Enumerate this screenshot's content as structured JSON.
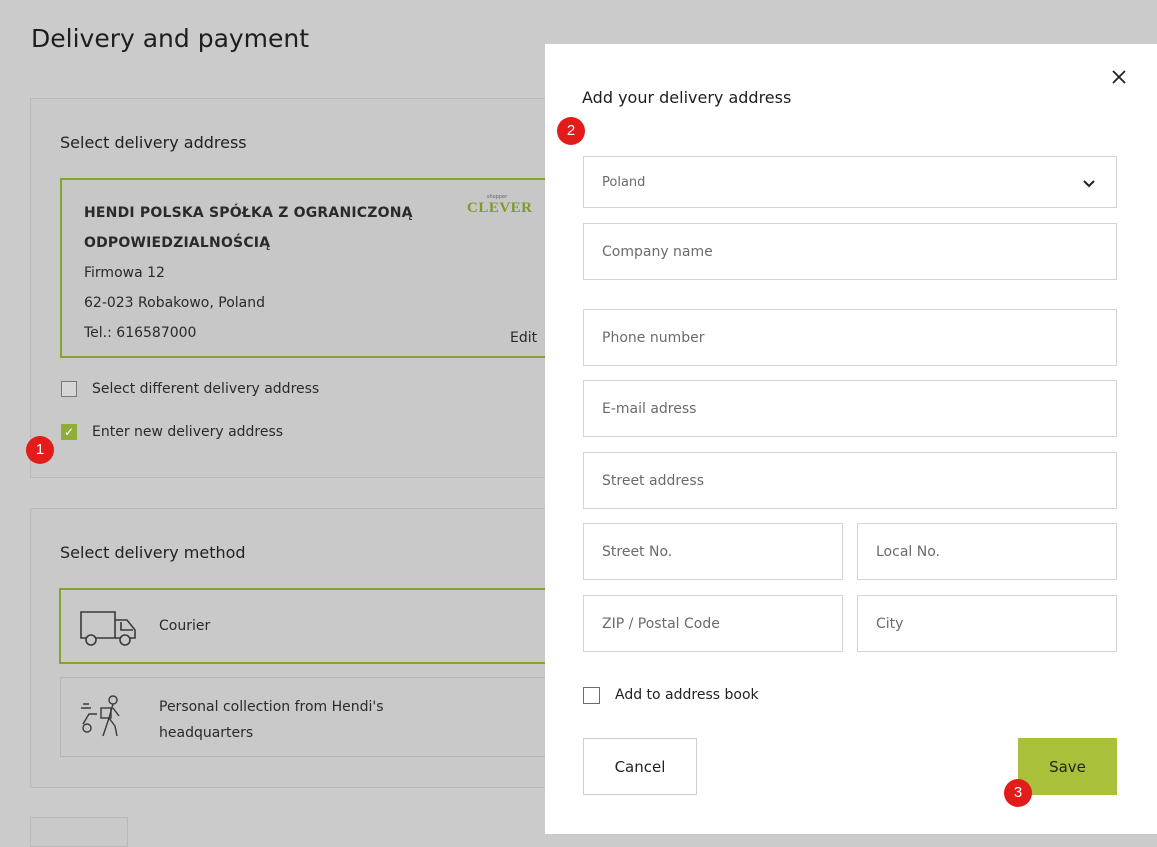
{
  "page": {
    "title": "Delivery and payment"
  },
  "address_section": {
    "title": "Select delivery address",
    "card": {
      "company_line1": "HENDI POLSKA SPÓŁKA Z OGRANICZONĄ",
      "company_line2": "ODPOWIEDZIALNOŚCIĄ",
      "street": "Firmowa 12",
      "city": "62-023 Robakowo, Poland",
      "phone": "Tel.: 616587000",
      "logo_small": "shopper",
      "logo": "CLEVER",
      "edit_label": "Edit"
    },
    "option_different": {
      "label": "Select different delivery address",
      "checked": false
    },
    "option_new": {
      "label": "Enter new delivery address",
      "checked": true
    }
  },
  "method_section": {
    "title": "Select delivery method",
    "methods": [
      {
        "label": "Courier",
        "icon": "truck-icon",
        "selected": true
      },
      {
        "label_line1": "Personal collection from Hendi's",
        "label_line2": "headquarters",
        "icon": "pickup-person-icon",
        "selected": false
      }
    ]
  },
  "modal": {
    "title": "Add your delivery address",
    "close_icon": "close-icon",
    "country": {
      "value": "Poland"
    },
    "fields": {
      "company": "Company name",
      "phone": "Phone number",
      "email": "E-mail adress",
      "street": "Street address",
      "street_no": "Street No.",
      "local_no": "Local No.",
      "zip": "ZIP / Postal Code",
      "city": "City"
    },
    "address_book": {
      "label": "Add to address book",
      "checked": false
    },
    "cancel_label": "Cancel",
    "save_label": "Save"
  },
  "annotations": {
    "badge1": "1",
    "badge2": "2",
    "badge3": "3"
  },
  "colors": {
    "accent": "#8fae37",
    "save_button": "#a9c03a",
    "badge": "#e21b1b",
    "overlay": "#cbcbcb"
  }
}
